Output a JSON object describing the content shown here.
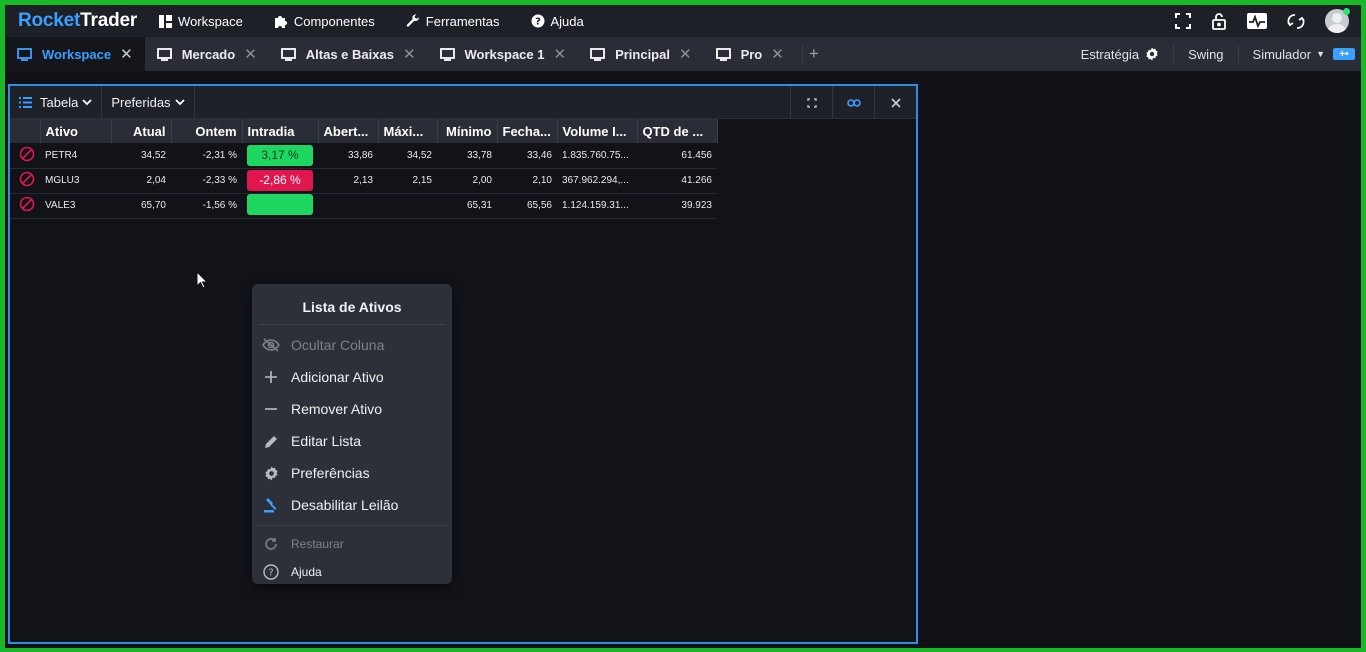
{
  "app": {
    "logo_part1": "Rocket",
    "logo_part2": "Trader"
  },
  "menu": [
    {
      "label": "Workspace",
      "icon": "grid-icon"
    },
    {
      "label": "Componentes",
      "icon": "puzzle-icon"
    },
    {
      "label": "Ferramentas",
      "icon": "wrench-icon"
    },
    {
      "label": "Ajuda",
      "icon": "help-icon"
    }
  ],
  "tabs": [
    {
      "label": "Workspace",
      "active": true
    },
    {
      "label": "Mercado",
      "active": false
    },
    {
      "label": "Altas e Baixas",
      "active": false
    },
    {
      "label": "Workspace 1",
      "active": false
    },
    {
      "label": "Principal",
      "active": false
    },
    {
      "label": "Pro",
      "active": false
    }
  ],
  "tabright": {
    "estrategia": "Estratégia",
    "swing": "Swing",
    "simulador": "Simulador"
  },
  "panel": {
    "view_label": "Tabela",
    "prefs_label": "Preferidas"
  },
  "table": {
    "columns": [
      "Ativo",
      "Atual",
      "Ontem",
      "Intradia",
      "Abert...",
      "Máxi...",
      "Mínimo",
      "Fecha...",
      "Volume I...",
      "QTD de ..."
    ],
    "rows": [
      {
        "ativo": "PETR4",
        "atual": "34,52",
        "ontem": "-2,31 %",
        "intradia": "3,17 %",
        "dir": "up",
        "abert": "33,86",
        "maxi": "34,52",
        "minimo": "33,78",
        "fecha": "33,46",
        "volume": "1.835.760.75...",
        "qtd": "61.456"
      },
      {
        "ativo": "MGLU3",
        "atual": "2,04",
        "ontem": "-2,33 %",
        "intradia": "-2,86 %",
        "dir": "down",
        "abert": "2,13",
        "maxi": "2,15",
        "minimo": "2,00",
        "fecha": "2,10",
        "volume": "367.962.294,...",
        "qtd": "41.266"
      },
      {
        "ativo": "VALE3",
        "atual": "65,70",
        "ontem": "-1,56 %",
        "intradia": "",
        "dir": "up",
        "abert": "",
        "maxi": "",
        "minimo": "65,31",
        "fecha": "65,56",
        "volume": "1.124.159.31...",
        "qtd": "39.923"
      }
    ]
  },
  "context_menu": {
    "title": "Lista de Ativos",
    "items": [
      {
        "label": "Ocultar Coluna",
        "icon": "eye-off-icon",
        "disabled": true
      },
      {
        "label": "Adicionar Ativo",
        "icon": "plus-icon",
        "disabled": false
      },
      {
        "label": "Remover Ativo",
        "icon": "minus-icon",
        "disabled": false
      },
      {
        "label": "Editar Lista",
        "icon": "pencil-icon",
        "disabled": false
      },
      {
        "label": "Preferências",
        "icon": "gear-icon",
        "disabled": false
      },
      {
        "label": "Desabilitar Leilão",
        "icon": "gavel-icon",
        "disabled": false
      },
      {
        "label": "Restaurar",
        "icon": "restore-icon",
        "disabled": true
      },
      {
        "label": "Ajuda",
        "icon": "help-circle-icon",
        "disabled": false
      }
    ]
  },
  "colors": {
    "accent": "#3aa0ff",
    "up": "#1ed760",
    "down": "#e0164e",
    "forbid": "#e0164e",
    "frame": "#18b829"
  }
}
